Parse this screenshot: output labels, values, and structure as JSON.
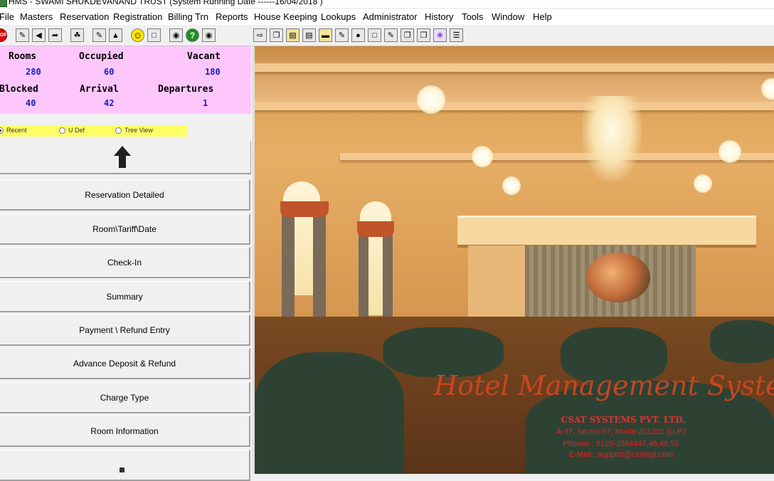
{
  "window": {
    "title": "HMS - SWAMI SHUKDEVANAND TRUST (System Running Date ------16/04/2018 )"
  },
  "menu": [
    "File",
    "Masters",
    "Reservation",
    "Registration",
    "Billing Trn",
    "Reports",
    "House Keeping",
    "Lookups",
    "Administrator",
    "History",
    "Tools",
    "Window",
    "Help"
  ],
  "toolbar": {
    "left_icons": [
      "stop-icon",
      "book-icon",
      "back-icon",
      "forward-icon",
      "cleaning-icon",
      "edit-icon",
      "chart-icon",
      "smiley-icon",
      "clipboard-icon",
      "search-image-icon",
      "help-icon",
      "binoculars-icon"
    ],
    "right_icons": [
      "move-icon",
      "copy-icon",
      "folder-icon",
      "document-icon",
      "card-icon",
      "pencil-icon",
      "person-icon",
      "page-icon",
      "tag-icon",
      "stack-icon",
      "stack2-icon",
      "butterfly-icon",
      "list-icon"
    ],
    "stop_text": "STOP",
    "help_text": "?"
  },
  "stats": {
    "rooms_label": "Rooms",
    "rooms_value": "280",
    "occupied_label": "Occupied",
    "occupied_value": "60",
    "vacant_label": "Vacant",
    "vacant_value": "180",
    "blocked_label": "Blocked",
    "blocked_value": "40",
    "arrival_label": "Arrival",
    "arrival_value": "42",
    "departures_label": "Departures",
    "departures_value": "1"
  },
  "view_options": {
    "selected": "Recent",
    "options": [
      "Recent",
      "U Def",
      "Tree View"
    ]
  },
  "nav_buttons": [
    "Reservation Detailed",
    "Room\\Tariff\\Date",
    "Check-In",
    "Summary",
    "Payment \\ Refund Entry",
    "Advance Deposit & Refund",
    "Charge Type",
    "Room Information"
  ],
  "splash": {
    "logo_text": "Hotel Management System",
    "company": "CSAT SYSTEMS PVT. LTD.",
    "address": "A-37, Sector-57, Noida-201301 (U.P.)",
    "phones": "Phones : 0120-2584447,48,49,50",
    "email": "E-Mail  : support@csatspl.com"
  },
  "colors": {
    "stats_bg": "#fdc7fd",
    "stats_value": "#1a1ac8",
    "radio_strip_bg": "#ffff66",
    "splash_text": "#e03030"
  }
}
